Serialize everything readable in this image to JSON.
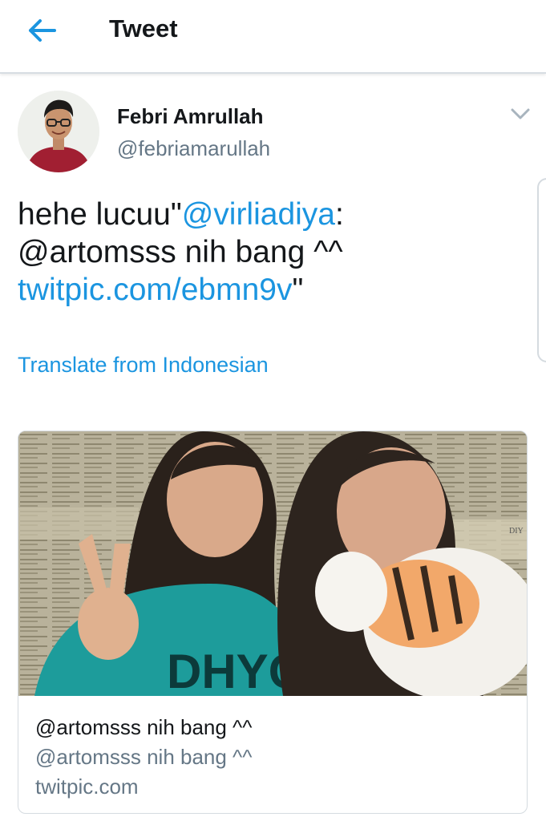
{
  "header": {
    "title": "Tweet"
  },
  "tweet": {
    "author_name": "Febri Amrullah",
    "author_handle": "@febriamarullah",
    "text": {
      "part1": "hehe lucuu\"",
      "mention1": "@virliadiya",
      "part2": ":",
      "line2": "@artomsss nih bang ^^",
      "link": "twitpic.com/ebmn9v",
      "part3": "\""
    },
    "translate_label": "Translate from Indonesian"
  },
  "card": {
    "title": "@artomsss nih bang ^^",
    "description": "@artomsss nih bang ^^",
    "domain": "twitpic.com",
    "photo_sign_text": "DIY"
  },
  "colors": {
    "accent": "#1b95e0",
    "text": "#14171a",
    "secondary": "#657786"
  },
  "icons": {
    "back": "arrow-left-icon",
    "more": "chevron-down-icon"
  }
}
